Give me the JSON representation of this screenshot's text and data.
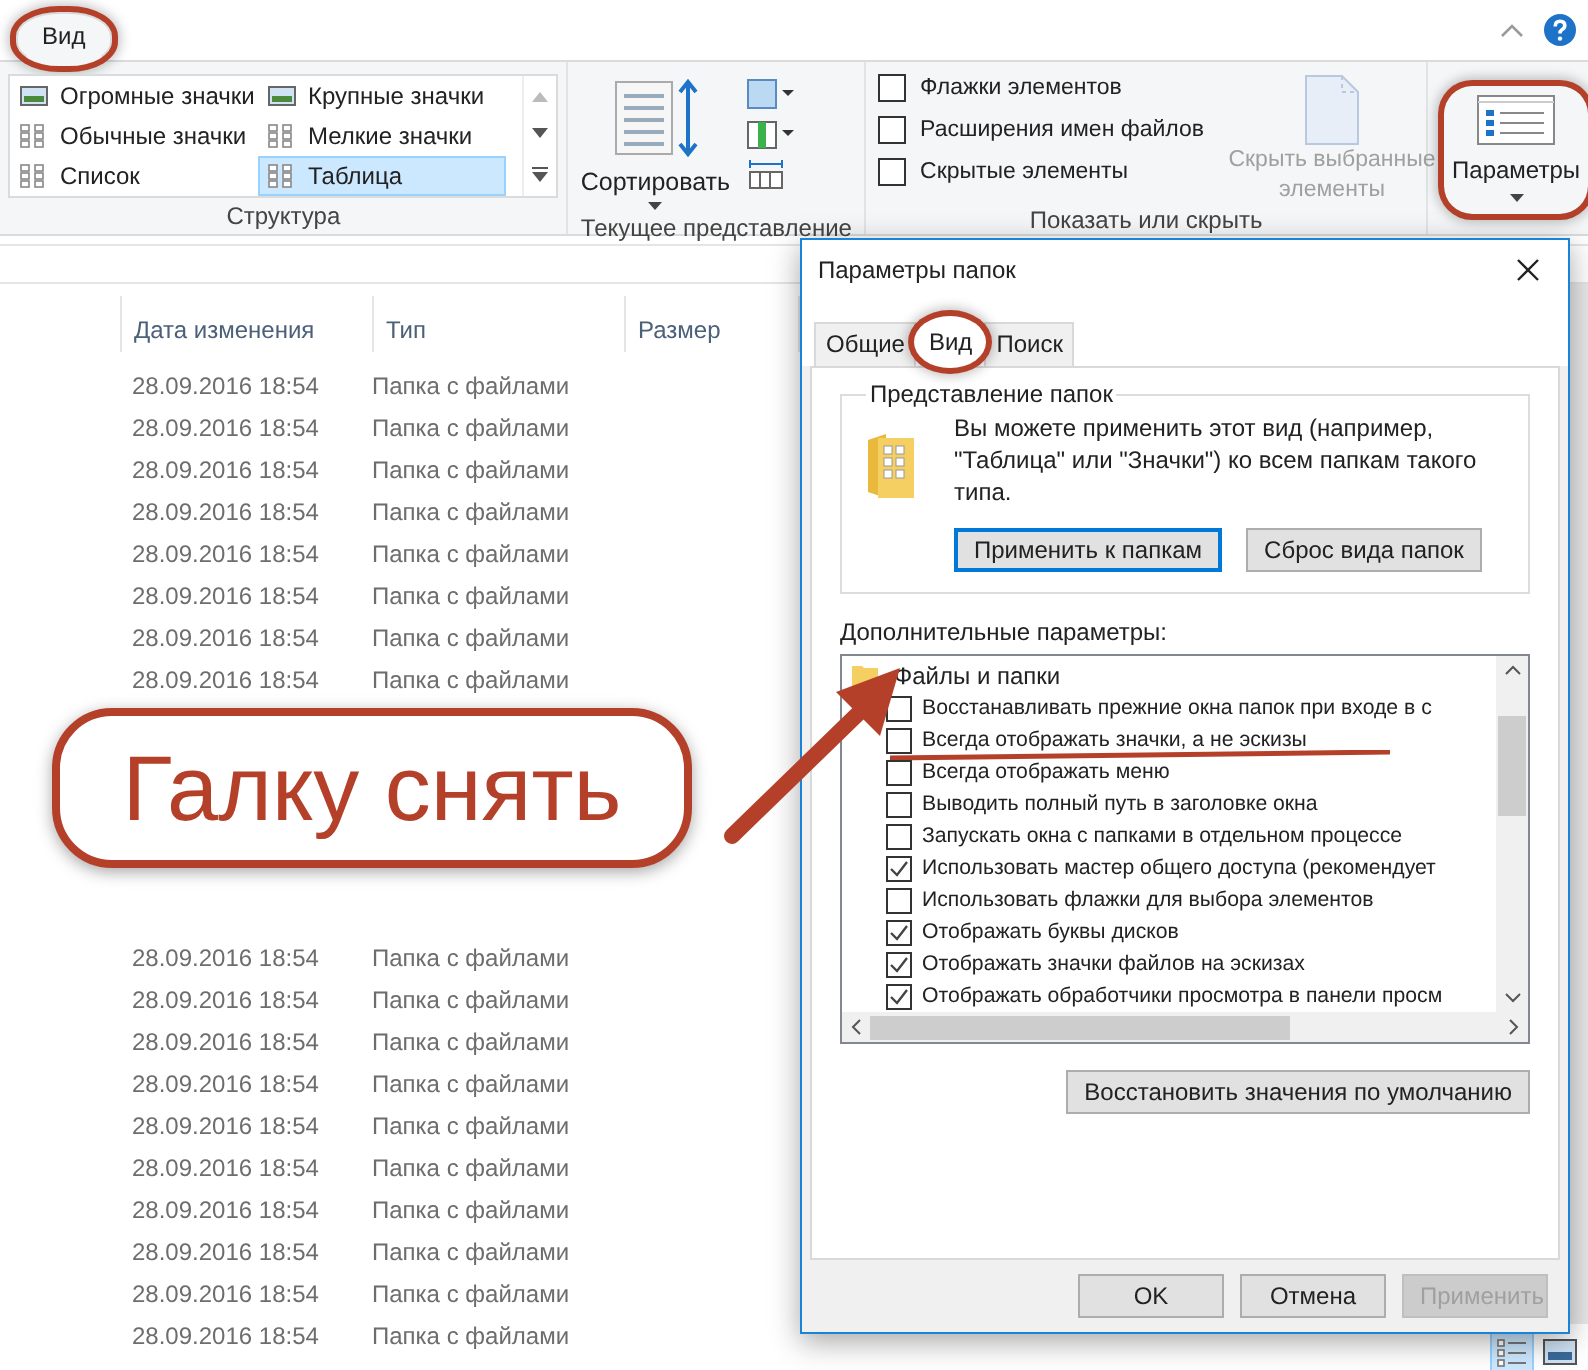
{
  "ribbon_tabs": [
    {
      "label": "Вид",
      "selected": true,
      "circled": true
    }
  ],
  "layout_group": {
    "title": "Структура",
    "items": [
      {
        "label": "Огромные значки",
        "selected": false
      },
      {
        "label": "Крупные значки",
        "selected": false
      },
      {
        "label": "Обычные значки",
        "selected": false
      },
      {
        "label": "Мелкие значки",
        "selected": false
      },
      {
        "label": "Список",
        "selected": false
      },
      {
        "label": "Таблица",
        "selected": true
      }
    ]
  },
  "current_view": {
    "title": "Текущее представление",
    "sort_label": "Сортировать"
  },
  "show_hide": {
    "title": "Показать или скрыть",
    "checkboxes": [
      {
        "label": "Флажки элементов",
        "checked": false
      },
      {
        "label": "Расширения имен файлов",
        "checked": false
      },
      {
        "label": "Скрытые элементы",
        "checked": false
      }
    ],
    "hide_selected": {
      "label": "Скрыть выбранные элементы",
      "disabled": true
    }
  },
  "options_button": {
    "label": "Параметры",
    "circled": true
  },
  "file_list": {
    "columns": [
      "Дата изменения",
      "Тип",
      "Размер"
    ],
    "rows_above": [
      {
        "date": "28.09.2016 18:54",
        "type": "Папка с файлами"
      },
      {
        "date": "28.09.2016 18:54",
        "type": "Папка с файлами"
      },
      {
        "date": "28.09.2016 18:54",
        "type": "Папка с файлами"
      },
      {
        "date": "28.09.2016 18:54",
        "type": "Папка с файлами"
      },
      {
        "date": "28.09.2016 18:54",
        "type": "Папка с файлами"
      },
      {
        "date": "28.09.2016 18:54",
        "type": "Папка с файлами"
      },
      {
        "date": "28.09.2016 18:54",
        "type": "Папка с файлами"
      },
      {
        "date": "28.09.2016 18:54",
        "type": "Папка с файлами"
      }
    ],
    "rows_below": [
      {
        "date": "28.09.2016 18:54",
        "type": "Папка с файлами"
      },
      {
        "date": "28.09.2016 18:54",
        "type": "Папка с файлами"
      },
      {
        "date": "28.09.2016 18:54",
        "type": "Папка с файлами"
      },
      {
        "date": "28.09.2016 18:54",
        "type": "Папка с файлами"
      },
      {
        "date": "28.09.2016 18:54",
        "type": "Папка с файлами"
      },
      {
        "date": "28.09.2016 18:54",
        "type": "Папка с файлами"
      },
      {
        "date": "28.09.2016 18:54",
        "type": "Папка с файлами"
      },
      {
        "date": "28.09.2016 18:54",
        "type": "Папка с файлами"
      },
      {
        "date": "28.09.2016 18:54",
        "type": "Папка с файлами"
      },
      {
        "date": "28.09.2016 18:54",
        "type": "Папка с файлами"
      }
    ]
  },
  "callout": {
    "text": "Галку снять"
  },
  "dialog": {
    "title": "Параметры папок",
    "tabs": [
      {
        "label": "Общие",
        "selected": false,
        "circled": false
      },
      {
        "label": "Вид",
        "selected": true,
        "circled": true
      },
      {
        "label": "Поиск",
        "selected": false,
        "circled": false
      }
    ],
    "folder_views": {
      "title": "Представление папок",
      "text": "Вы можете применить этот вид (например, \"Таблица\" или \"Значки\") ко всем папкам такого типа.",
      "buttons": [
        {
          "label": "Применить к папкам",
          "default": true
        },
        {
          "label": "Сброс вида папок",
          "default": false
        }
      ]
    },
    "advanced_label": "Дополнительные параметры:",
    "tree": {
      "label": "Файлы и папки",
      "children": [
        {
          "label": "Восстанавливать прежние окна папок при входе в с",
          "checked": false,
          "underlined": false
        },
        {
          "label": "Всегда отображать значки, а не эскизы",
          "checked": false,
          "underlined": true
        },
        {
          "label": "Всегда отображать меню",
          "checked": false,
          "underlined": false
        },
        {
          "label": "Выводить полный путь в заголовке окна",
          "checked": false,
          "underlined": false
        },
        {
          "label": "Запускать окна с папками в отдельном процессе",
          "checked": false,
          "underlined": false
        },
        {
          "label": "Использовать мастер общего доступа (рекомендует",
          "checked": true,
          "underlined": false
        },
        {
          "label": "Использовать флажки для выбора элементов",
          "checked": false,
          "underlined": false
        },
        {
          "label": "Отображать буквы дисков",
          "checked": true,
          "underlined": false
        },
        {
          "label": "Отображать значки файлов на эскизах",
          "checked": true,
          "underlined": false
        },
        {
          "label": "Отображать обработчики просмотра в панели просм",
          "checked": true,
          "underlined": false
        }
      ]
    },
    "restore_button": "Восстановить значения по умолчанию",
    "footer_buttons": [
      {
        "label": "OK",
        "disabled": false
      },
      {
        "label": "Отмена",
        "disabled": false
      },
      {
        "label": "Применить",
        "disabled": true
      }
    ]
  }
}
